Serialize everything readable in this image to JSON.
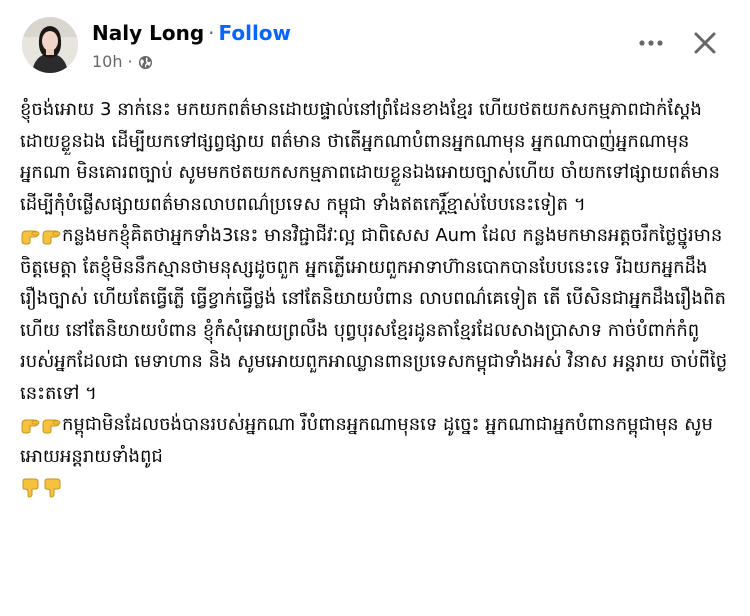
{
  "post": {
    "author": "Naly Long",
    "separator": "·",
    "follow_label": "Follow",
    "time": "10h",
    "privacy_icon": "globe-icon"
  },
  "actions": {
    "more_icon": "more-horizontal-icon",
    "close_icon": "close-icon"
  },
  "content": {
    "p1": "ខ្ញុំចង់អោយ 3 នាក់នេះ មកយកពត៌មានដោយផ្ទាល់នៅព្រំដែនខាងខ្មែរ ហើយថតយកសកម្មភាពជាក់ស្ដែងដោយខ្លួនឯង ដើម្បីយកទៅផ្សព្វផ្សាយ ពត៌មាន ថាតើអ្នកណាបំពានអ្នកណាមុន អ្នកណាបាញ់អ្នកណាមុន អ្នកណា មិនគោរពច្បាប់ សូមមកថតយកសកម្មភាពដោយខ្លួនឯងអោយច្បាស់ហើយ ចាំយកទៅផ្សាយពត៌មាន ដើម្បីកុំបំផ្លើសផ្សាយពត៌មានលាបពណ៌ប្រទេស កម្ពុជា ទាំងឥតកេរ្តិ៍ខ្មាស់បែបនេះទៀត ។",
    "p2": "កន្លងមកខ្ញុំគិតថាអ្នកទាំង3នេះ មានវិជ្ជាជីវៈល្អ ជាពិសេស Aum ដែល កន្លងមកមានអត្តចរឹកថ្លៃថ្នូរមានចិត្តមេត្តា តែខ្ញុំមិននឹកស្មានថាមនុស្សដូចពួក អ្នកភ្លើអោយពួកអាទាហ៊ានបោកបានបែបនេះទេ រីឯយកអ្នកដឹងរឿងច្បាស់ ហើយតែធ្វើភ្លើ ធ្វើខ្វាក់ធ្វើថ្លង់ នៅតែនិយាយបំពាន លាបពណ៌គេទៀត តើ បើសិនជាអ្នកដឹងរឿងពិតហើយ នៅតែនិយាយបំពាន ខ្ញុំកំសុំអោយព្រលឹង បុព្វបុរសខ្មែរដូនតាខ្មែរដែលសាងប្រាសាទ កាច់បំពាក់កំពូរបស់អ្នកដែលជា មេទាហាន និង សូមអោយពួកអាឈ្លានពានប្រទេសកម្ពុជាទាំងអស់ វិនាស អន្តរាយ ចាប់ពីថ្ងៃនេះតទៅ ។",
    "p3": "កម្ពុជាមិនដែលចង់បានរបស់អ្នកណា រឺបំពានអ្នកណាមុនទេ ដូច្នេះ អ្នកណាជាអ្នកបំពានកម្ពុជាមុន សូមអោយអន្តរាយទាំងពូជ",
    "emoji_pointing": "backhand-index-pointing-right-icon",
    "emoji_thumbs_down": "thumbs-down-icon"
  }
}
